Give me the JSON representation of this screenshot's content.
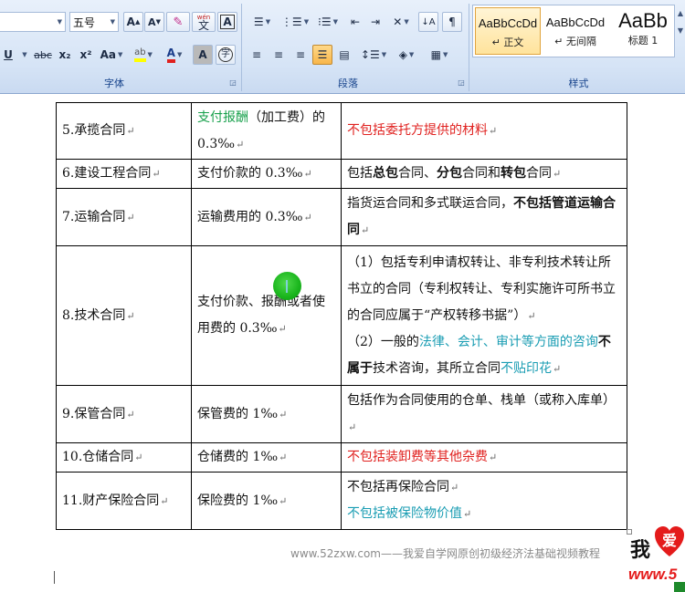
{
  "ribbon": {
    "font_size_value": "五号",
    "groups": {
      "font": "字体",
      "paragraph": "段落",
      "styles": "样式"
    },
    "font_buttons": {
      "grow": "A",
      "shrink": "A",
      "phonetic": "wén",
      "phonetic_char": "文",
      "char_border": "A",
      "underline": "U",
      "strike": "abc",
      "subscript": "x₂",
      "superscript": "x²",
      "change_case": "Aa",
      "highlight": "ab",
      "font_color": "A",
      "char_shading": "A",
      "enclose": "字"
    },
    "styles": [
      {
        "sample": "AaBbCcDd",
        "name": "↵ 正文"
      },
      {
        "sample": "AaBbCcDd",
        "name": "↵ 无间隔"
      },
      {
        "sample": "AaBb",
        "name": "标题 1"
      }
    ],
    "colors": {
      "highlight": "#ffff00",
      "font_color": "#e0211f"
    }
  },
  "document": {
    "rows": [
      {
        "name": "5.承揽合同",
        "rate": [
          {
            "t": "支付报酬",
            "c": "green"
          },
          {
            "t": "（加工费）的0.3‰"
          }
        ],
        "note": [
          [
            {
              "t": "不包括委托方提供的材料",
              "c": "red"
            }
          ]
        ]
      },
      {
        "name": "6.建设工程合同",
        "rate": [
          {
            "t": "支付价款的 0.3‰"
          }
        ],
        "note": [
          [
            {
              "t": "包括"
            },
            {
              "t": "总包",
              "b": true
            },
            {
              "t": "合同、"
            },
            {
              "t": "分包",
              "b": true
            },
            {
              "t": "合同和"
            },
            {
              "t": "转包",
              "b": true
            },
            {
              "t": "合同"
            }
          ]
        ]
      },
      {
        "name": "7.运输合同",
        "rate": [
          {
            "t": "运输费用的 0.3‰"
          }
        ],
        "note": [
          [
            {
              "t": "指货运合同和多式联运合同，"
            },
            {
              "t": "不包括管道运输合同",
              "b": true
            }
          ]
        ]
      },
      {
        "name": "8.技术合同",
        "rate": [
          {
            "t": "支付价款、报酬或者使用费的 0.3‰"
          }
        ],
        "note": [
          [
            {
              "t": "（1）包括专利申请权转让、非专利技术转让所书立的合同（专利权转让、专利实施许可所书立的合同应属于“产权转移书据”）"
            }
          ],
          [
            {
              "t": "（2）一般的"
            },
            {
              "t": "法律、会计、审计等方面的咨询",
              "c": "teal"
            },
            {
              "t": "不属于",
              "b": true
            },
            {
              "t": "技术咨询，其所立合同"
            },
            {
              "t": "不贴印花",
              "c": "teal"
            }
          ]
        ]
      },
      {
        "name": "9.保管合同",
        "rate": [
          {
            "t": "保管费的 1‰"
          }
        ],
        "note": [
          [
            {
              "t": "包括作为合同使用的仓单、栈单（或称入库单）"
            }
          ]
        ]
      },
      {
        "name": "10.仓储合同",
        "rate": [
          {
            "t": "仓储费的 1‰"
          }
        ],
        "note": [
          [
            {
              "t": "不包括装卸费等其他杂费",
              "c": "red"
            }
          ]
        ]
      },
      {
        "name": "11.财产保险合同",
        "rate": [
          {
            "t": "保险费的 1‰"
          }
        ],
        "note": [
          [
            {
              "t": "不包括再保险合同"
            }
          ],
          [
            {
              "t": "不包括被保险物价值",
              "c": "teal"
            }
          ]
        ]
      }
    ],
    "watermark": "www.52zxw.com——我爱自学网原创初级经济法基础视频教程",
    "logo": {
      "cn": "我",
      "heart_char": "爱",
      "www": "www.5"
    }
  }
}
